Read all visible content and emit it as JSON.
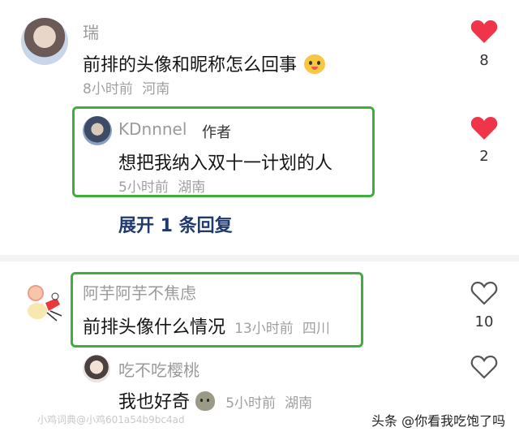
{
  "comments": [
    {
      "name": "瑞",
      "text": "前排的头像和昵称怎么回事",
      "time": "8小时前",
      "location": "河南",
      "likes": "8",
      "liked": true
    },
    {
      "name": "阿芋阿芋不焦虑",
      "text": "前排头像什么情况",
      "time": "13小时前",
      "location": "四川",
      "likes": "10",
      "liked": false
    }
  ],
  "replies": [
    {
      "name": "KDnnnel",
      "badge": "作者",
      "text": "想把我纳入双十一计划的人",
      "time": "5小时前",
      "location": "湖南",
      "likes": "2",
      "liked": true
    },
    {
      "name": "吃不吃樱桃",
      "text": "我也好奇",
      "time": "5小时前",
      "location": "湖南",
      "likes": "",
      "liked": false
    }
  ],
  "expand_label": "展开 1 条回复",
  "watermark": "小鸡词典@小鸡601a54b9bc4ad",
  "brand": "头条 @你看我吃饱了吗",
  "colors": {
    "liked": "#f0354a",
    "highlight_box": "#3fae3a",
    "link": "#203a6e"
  }
}
